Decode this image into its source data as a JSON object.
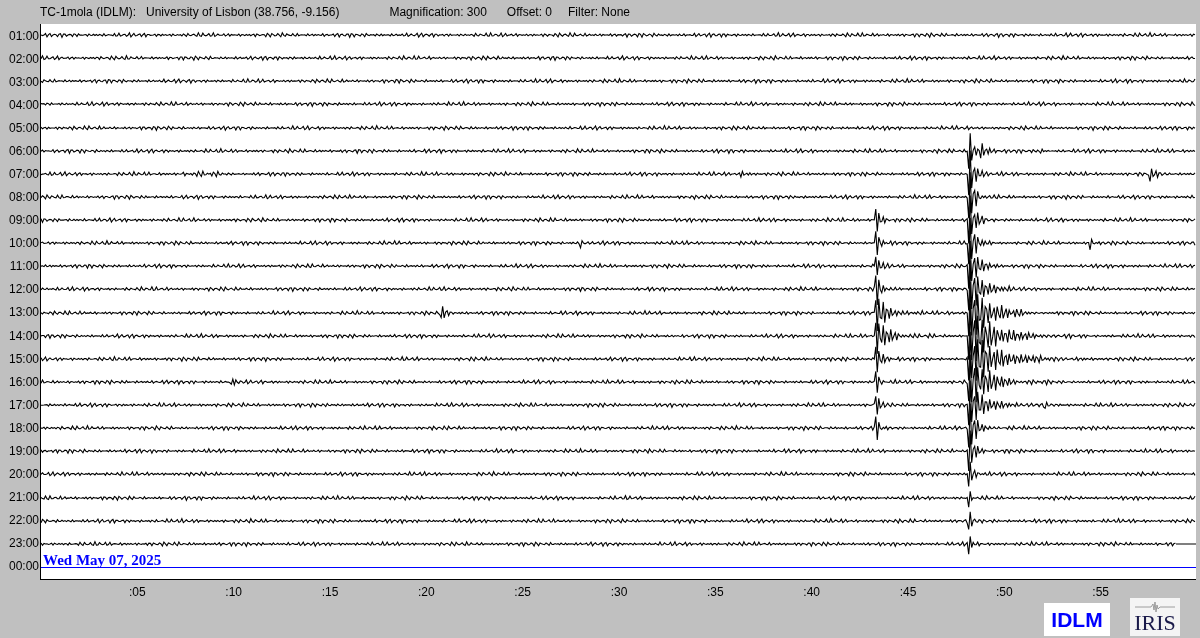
{
  "header": {
    "station": "TC-1mola (IDLM):",
    "location": "University of Lisbon (38.756, -9.156)",
    "magnification": "Magnification: 300",
    "offset": "Offset: 0",
    "filter": "Filter: None"
  },
  "rows": [
    {
      "label": "01:00",
      "kind": "trace"
    },
    {
      "label": "02:00",
      "kind": "trace"
    },
    {
      "label": "03:00",
      "kind": "trace"
    },
    {
      "label": "04:00",
      "kind": "trace"
    },
    {
      "label": "05:00",
      "kind": "trace"
    },
    {
      "label": "06:00",
      "kind": "trace"
    },
    {
      "label": "07:00",
      "kind": "trace"
    },
    {
      "label": "08:00",
      "kind": "trace"
    },
    {
      "label": "09:00",
      "kind": "trace"
    },
    {
      "label": "10:00",
      "kind": "trace"
    },
    {
      "label": "11:00",
      "kind": "trace"
    },
    {
      "label": "12:00",
      "kind": "trace"
    },
    {
      "label": "13:00",
      "kind": "trace"
    },
    {
      "label": "14:00",
      "kind": "trace"
    },
    {
      "label": "15:00",
      "kind": "trace"
    },
    {
      "label": "16:00",
      "kind": "trace"
    },
    {
      "label": "17:00",
      "kind": "trace"
    },
    {
      "label": "18:00",
      "kind": "trace"
    },
    {
      "label": "19:00",
      "kind": "trace"
    },
    {
      "label": "20:00",
      "kind": "trace"
    },
    {
      "label": "21:00",
      "kind": "trace"
    },
    {
      "label": "22:00",
      "kind": "trace"
    },
    {
      "label": "23:00",
      "kind": "partial"
    },
    {
      "label": "00:00",
      "kind": "current",
      "date": "Wed May 07, 2025"
    }
  ],
  "x_ticks": [
    ":05",
    ":10",
    ":15",
    ":20",
    ":25",
    ":30",
    ":35",
    ":40",
    ":45",
    ":50",
    ":55"
  ],
  "logos": {
    "station": "IDLM",
    "network": "IRIS"
  }
}
